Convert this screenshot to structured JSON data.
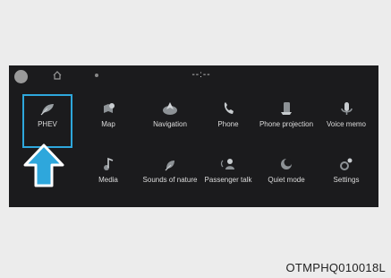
{
  "status_bar": {
    "clock": "--:--"
  },
  "apps": [
    {
      "label": "PHEV",
      "icon": "phev-icon",
      "selected": true
    },
    {
      "label": "Map",
      "icon": "map-icon"
    },
    {
      "label": "Navigation",
      "icon": "navigation-icon"
    },
    {
      "label": "Phone",
      "icon": "phone-icon"
    },
    {
      "label": "Phone projection",
      "icon": "phone-projection-icon"
    },
    {
      "label": "Voice memo",
      "icon": "voice-memo-icon"
    },
    {
      "label": "Media",
      "icon": "media-icon"
    },
    {
      "label": "Sounds of nature",
      "icon": "sounds-of-nature-icon"
    },
    {
      "label": "Passenger talk",
      "icon": "passenger-talk-icon"
    },
    {
      "label": "Quiet mode",
      "icon": "quiet-mode-icon"
    },
    {
      "label": "Settings",
      "icon": "settings-icon"
    }
  ],
  "colors": {
    "highlight": "#2ea7dc",
    "screen_bg": "#1b1b1d",
    "label": "#dcdcdc"
  },
  "figure_code": "OTMPHQ010018L"
}
